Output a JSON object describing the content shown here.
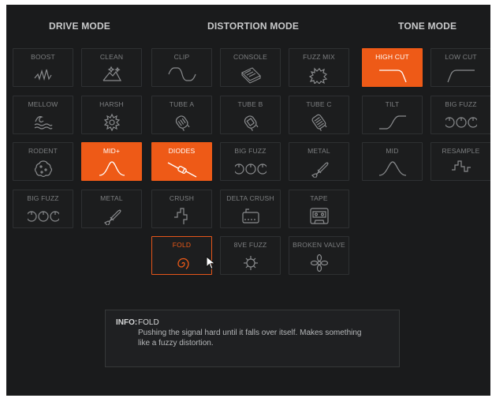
{
  "sections": {
    "drive": "DRIVE MODE",
    "distortion": "DISTORTION MODE",
    "tone": "TONE MODE"
  },
  "drive": {
    "boost": "BOOST",
    "clean": "CLEAN",
    "mellow": "MELLOW",
    "harsh": "HARSH",
    "rodent": "RODENT",
    "mid_plus": "MID+",
    "big_fuzz": "BIG FUZZ",
    "metal": "METAL"
  },
  "distortion": {
    "clip": "CLIP",
    "console": "CONSOLE",
    "fuzz_mix": "FUZZ MIX",
    "tube_a": "TUBE A",
    "tube_b": "TUBE B",
    "tube_c": "TUBE C",
    "diodes": "DIODES",
    "big_fuzz": "BIG FUZZ",
    "metal": "METAL",
    "crush": "CRUSH",
    "delta_crush": "DELTA CRUSH",
    "tape": "TAPE",
    "fold": "FOLD",
    "eight_ve_fuzz": "8VE FUZZ",
    "broken_valve": "BROKEN VALVE"
  },
  "tone": {
    "high_cut": "HIGH CUT",
    "low_cut": "LOW CUT",
    "tilt": "TILT",
    "big_fuzz": "BIG FUZZ",
    "mid": "MID",
    "resample": "RESAMPLE"
  },
  "info": {
    "key": "INFO:",
    "title": "FOLD",
    "text": "Pushing the signal hard until it falls over itself. Makes something like a fuzzy distortion."
  },
  "colors": {
    "panel_bg": "#1a1b1c",
    "tile_bg": "#1c1d1e",
    "accent": "#ee5a17",
    "label": "#7d7f81"
  }
}
